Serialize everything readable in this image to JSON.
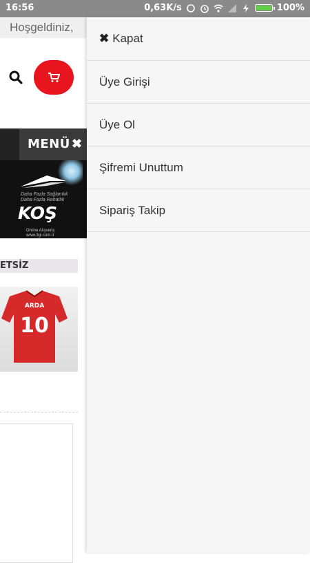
{
  "status_bar": {
    "time": "16:56",
    "network_speed": "0,63K/s",
    "battery_percent": "100%"
  },
  "header": {
    "welcome_text": "Hoşgeldiniz,",
    "search_icon": "search-icon",
    "cart_icon": "cart-icon",
    "cart_color": "#e8141e"
  },
  "menu_bar": {
    "label": "MENÜ",
    "close_glyph": "✖"
  },
  "banner": {
    "tagline_line1": "Daha Fazla Sağlamlık",
    "tagline_line2": "Daha Fazla Rahatlık",
    "title": "KOŞ",
    "footer_line1": "Online Alışveriş",
    "footer_line2": "www.3gi.com.tr"
  },
  "section": {
    "heading_fragment": "ETSİZ"
  },
  "product": {
    "jersey_name": "ARDA",
    "jersey_number": "10"
  },
  "drawer": {
    "close_label": "Kapat",
    "items": [
      {
        "label": "Üye Girişi"
      },
      {
        "label": "Üye Ol"
      },
      {
        "label": "Şifremi Unuttum"
      },
      {
        "label": "Sipariş Takip"
      }
    ]
  }
}
